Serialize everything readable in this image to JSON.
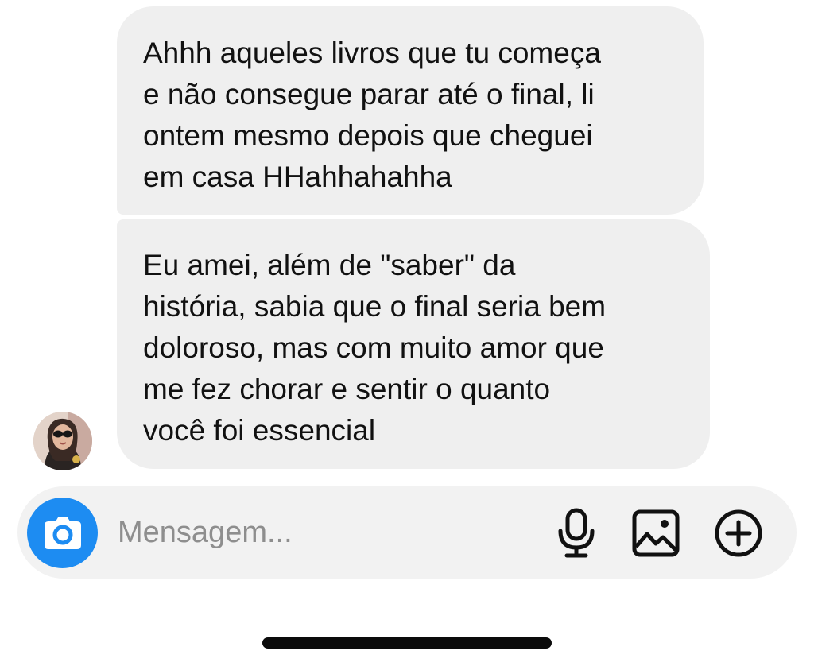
{
  "conversation": {
    "messages": [
      {
        "sender": "contact",
        "lines": [
          "Ahhh aqueles livros que tu começa",
          "e não consegue parar até o final, li",
          "ontem mesmo depois que cheguei",
          "em casa HHahhahahha"
        ]
      },
      {
        "sender": "contact",
        "lines": [
          "Eu amei, além de \"saber\" da",
          "história, sabia que o final seria bem",
          "doloroso, mas com muito amor que",
          "me fez chorar e sentir o quanto",
          "você foi essencial"
        ]
      }
    ]
  },
  "composer": {
    "placeholder": "Mensagem...",
    "value": "",
    "icons": {
      "camera": "camera-icon",
      "mic": "microphone-icon",
      "gallery": "image-icon",
      "plus": "plus-circle-icon"
    }
  },
  "colors": {
    "bubble_background": "#efefef",
    "composer_background": "#f2f2f2",
    "camera_accent": "#1d8cf2",
    "placeholder_text": "#8e8e8e",
    "message_text": "#111111"
  }
}
